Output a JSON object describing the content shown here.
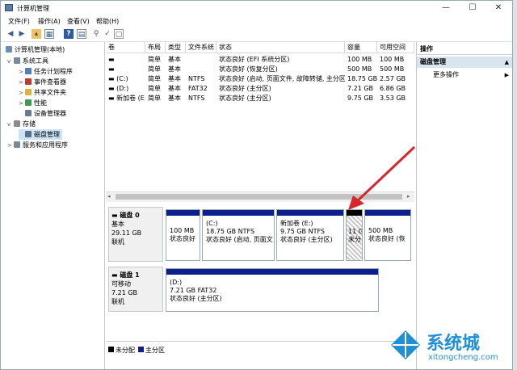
{
  "window": {
    "title": "计算机管理",
    "controls": {
      "minimize": "—",
      "maximize": "☐",
      "close": "✕"
    }
  },
  "menu": [
    "文件(F)",
    "操作(A)",
    "查看(V)",
    "帮助(H)"
  ],
  "tree": {
    "root": "计算机管理(本地)",
    "system_tools": "系统工具",
    "task_scheduler": "任务计划程序",
    "event_viewer": "事件查看器",
    "shared_folders": "共享文件夹",
    "performance": "性能",
    "device_manager": "设备管理器",
    "storage": "存储",
    "disk_management": "磁盘管理",
    "services": "服务和应用程序"
  },
  "volume_table": {
    "headers": [
      "卷",
      "布局",
      "类型",
      "文件系统",
      "状态",
      "容量",
      "可用空间"
    ],
    "rows": [
      [
        "",
        "简单",
        "基本",
        "",
        "状态良好 (EFI 系统分区)",
        "100 MB",
        "100 MB"
      ],
      [
        "",
        "简单",
        "基本",
        "",
        "状态良好 (恢复分区)",
        "500 MB",
        "500 MB"
      ],
      [
        "(C:)",
        "简单",
        "基本",
        "NTFS",
        "状态良好 (启动, 页面文件, 故障转储, 主分区)",
        "18.75 GB",
        "2.57 GB"
      ],
      [
        "(D:)",
        "简单",
        "基本",
        "FAT32",
        "状态良好 (主分区)",
        "7.21 GB",
        "6.86 GB"
      ],
      [
        "新加卷 (E:)",
        "简单",
        "基本",
        "NTFS",
        "状态良好 (主分区)",
        "9.75 GB",
        "3.53 GB"
      ]
    ]
  },
  "disks": [
    {
      "name": "磁盘 0",
      "type": "基本",
      "size": "29.11 GB",
      "status": "联机",
      "partitions": [
        {
          "label": "",
          "line1": "100 MB",
          "line2": "状态良好"
        },
        {
          "label": "(C:)",
          "line1": "18.75 GB NTFS",
          "line2": "状态良好 (启动, 页面文"
        },
        {
          "label": "新加卷 (E:)",
          "line1": "9.75 GB NTFS",
          "line2": "状态良好 (主分区)"
        },
        {
          "label": "",
          "line1": "11 G",
          "line2": "未分"
        },
        {
          "label": "",
          "line1": "500 MB",
          "line2": "状态良好 (恢"
        }
      ]
    },
    {
      "name": "磁盘 1",
      "type": "可移动",
      "size": "7.21 GB",
      "status": "联机",
      "partitions": [
        {
          "label": "(D:)",
          "line1": "7.21 GB FAT32",
          "line2": "状态良好 (主分区)"
        }
      ]
    }
  ],
  "legend": {
    "unallocated": "未分配",
    "primary": "主分区"
  },
  "actions": {
    "header": "操作",
    "section": "磁盘管理",
    "more": "更多操作"
  },
  "watermark": {
    "brand": "系统城",
    "url": "xitongcheng.com"
  },
  "colors": {
    "partition_bar": "#0c1f8c",
    "unallocated": "#000000",
    "arrow": "#d9262b",
    "selection": "#cce4f7"
  }
}
